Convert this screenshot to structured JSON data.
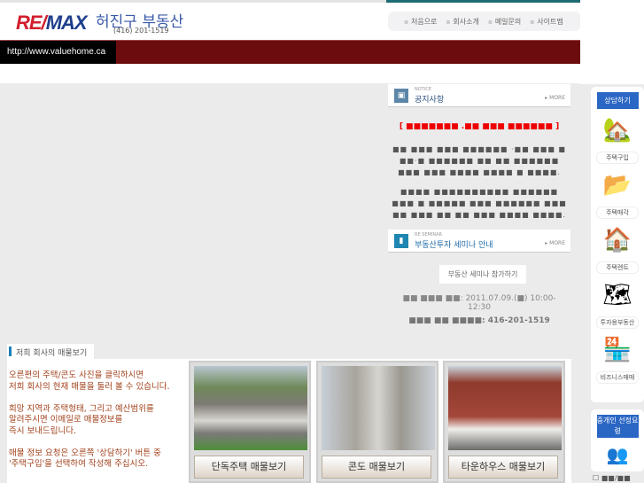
{
  "header": {
    "logo": "RE/MAX",
    "company": "허진구 부동산",
    "phone": "(416) 201-1519",
    "url": "http://www.valuehome.ca"
  },
  "topnav": [
    "처음으로",
    "회사소개",
    "메일문의",
    "사이트맵"
  ],
  "notice": {
    "sub": "NOTICE",
    "title": "공지사항",
    "more": "MORE",
    "headline": "[ ■■■■■■■ .■■ ■■■ ■■■■■■ ]",
    "p1": "■■ ■■■ ■■■ ■■■■■■ ·■■ ■■■ ■ ■■·■ ■■■■■■ ■■ ■■ ■■■■■■ ■■■ ■■■ ■■■■ ■■■■ ■ ■■■■.",
    "p2": "■■■■ ■■■■■■■■■■ ■■■■■■ ■■■ ■ ■■■■■ ■■■ ■■■■■■ ■■■ ■■ ■■■ ■■ ■■ ■■■ ■■■■ ■■■■."
  },
  "seminar": {
    "sub": "RE SEMINAR",
    "title": "부동산투자 세미나 안내",
    "more": "MORE",
    "button": "부동산 세미나 참가하기",
    "date_line": "■■ ■■■ ■■: 2011.07.09.(■) 10:00-12:30",
    "contact_line": "■■■ ■■ ■■■■: 416-201-1519"
  },
  "sidebar": {
    "consult": "상담하기",
    "items": [
      "주택구입",
      "주택매각",
      "주택렌트",
      "투자용부동산",
      "비즈니스매매"
    ],
    "agent": "중개인 선정요령",
    "checkbox": "■■/■■"
  },
  "listings": {
    "heading": "저희 회사의 매물보기",
    "description": "오른편의 주택/콘도 사진을 클릭하시면\n저희 회사의 현재 매물을 둘러 볼 수 있습니다.\n\n희망 지역과 주택형태, 그리고 예산범위를\n알려주시면 이메일로 매물정보를\n즉시 보내드립니다.\n\n매물 정보 요청은 오른쪽 '상담하기' 버튼 중\n'주택구입'을 선택하여 작성해 주십시오.",
    "cards": [
      "단독주택 매물보기",
      "콘도 매물보기",
      "타운하우스 매물보기"
    ]
  }
}
